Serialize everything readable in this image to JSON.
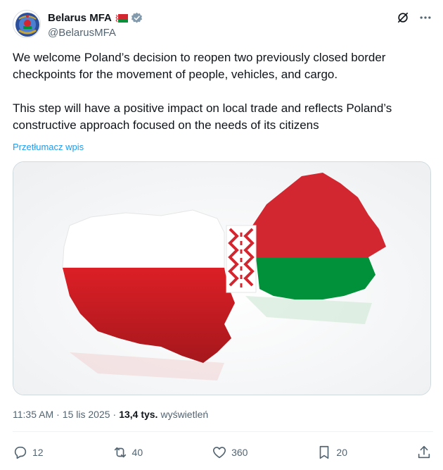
{
  "account": {
    "name": "Belarus MFA",
    "handle": "@BelarusMFA",
    "verified_color": "#829aab"
  },
  "header_icons": [
    "grok-icon",
    "more-icon"
  ],
  "tweet": {
    "text": "We welcome Poland’s decision to reopen two previously closed border checkpoints for the movement of people, vehicles, and cargo.\n\nThis step will have a positive impact on local trade and reflects Poland’s constructive approach focused on the needs of its citizens",
    "translate_label": "Przetłumacz wpis"
  },
  "meta": {
    "time": "11:35 AM",
    "sep1": "·",
    "date": "15 lis 2025",
    "sep2": "·",
    "views_count": "13,4 tys.",
    "views_label": "wyświetleń"
  },
  "actions": {
    "replies": "12",
    "reposts": "40",
    "likes": "360",
    "bookmarks": "20"
  },
  "colors": {
    "link": "#1d9bf0",
    "secondary_text": "#536471",
    "poland_red": "#dc1f26",
    "belarus_red": "#d22730",
    "belarus_green": "#00913a"
  }
}
